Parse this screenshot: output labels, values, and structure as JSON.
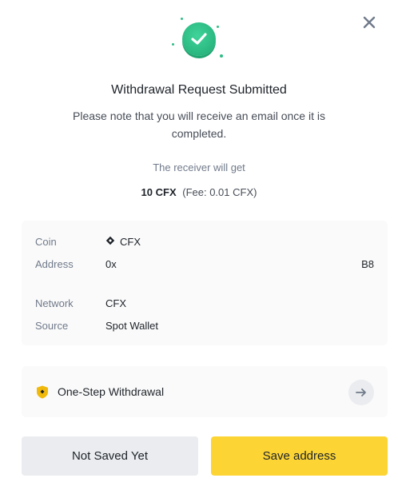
{
  "dialog": {
    "title": "Withdrawal Request Submitted",
    "note": "Please note that you will receive an email once it is completed.",
    "receiver_label": "The receiver will get",
    "amount": "10 CFX",
    "fee": "(Fee: 0.01 CFX)",
    "success_icon": "check-circle-icon",
    "close_icon": "close-icon"
  },
  "details": {
    "coin": {
      "label": "Coin",
      "value": "CFX",
      "icon": "cfx-coin-icon"
    },
    "address": {
      "label": "Address",
      "value": "0x",
      "tail": "B8"
    },
    "network": {
      "label": "Network",
      "value": "CFX"
    },
    "source": {
      "label": "Source",
      "value": "Spot Wallet"
    }
  },
  "one_step": {
    "label": "One-Step Withdrawal",
    "icon": "shield-icon",
    "arrow_icon": "arrow-right-icon"
  },
  "buttons": {
    "secondary": "Not Saved Yet",
    "primary": "Save address"
  },
  "colors": {
    "success": "#2ebd85",
    "primary_button": "#fcd535",
    "secondary_button": "#eaecef",
    "panel_bg": "#fafafa",
    "muted_text": "#707a8a"
  }
}
